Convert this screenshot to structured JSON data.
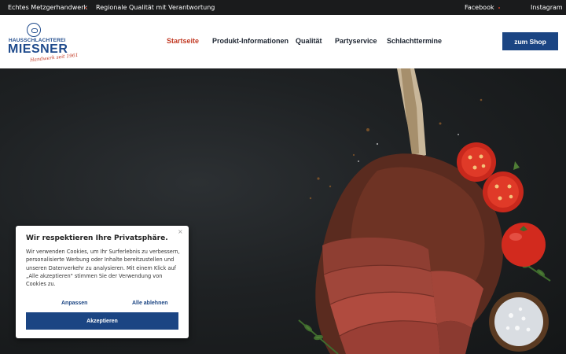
{
  "topbar": {
    "left_1": "Echtes Metzgerhandwerk",
    "left_2": "Regionale Qualität mit Verantwortung",
    "facebook": "Facebook",
    "instagram": "Instagram"
  },
  "logo": {
    "line1": "HAUSSCHLACHTEREI",
    "line2": "MIESNER",
    "tagline": "Handwerk seit 1961"
  },
  "nav": {
    "items": [
      {
        "label": "Startseite",
        "active": true
      },
      {
        "label": "Produkt-Informationen",
        "active": false
      },
      {
        "label": "Qualität",
        "active": false
      },
      {
        "label": "Partyservice",
        "active": false
      },
      {
        "label": "Schlachttermine",
        "active": false
      }
    ],
    "shop_button": "zum Shop"
  },
  "cookie": {
    "title": "Wir respektieren Ihre Privatsphäre.",
    "close": "×",
    "text": "Wir verwenden Cookies, um Ihr Surferlebnis zu verbessern, personalisierte Werbung oder Inhalte bereitzustellen und unseren Datenverkehr zu analysieren. Mit einem Klick auf „Alle akzeptieren\" stimmen Sie der Verwendung von Cookies zu.",
    "customize": "Anpassen",
    "reject": "Alle ablehnen",
    "accept": "Akzeptieren"
  },
  "colors": {
    "brand_blue": "#1b4583",
    "accent_red": "#c23a24",
    "topbar_bg": "#1a1b1c"
  }
}
